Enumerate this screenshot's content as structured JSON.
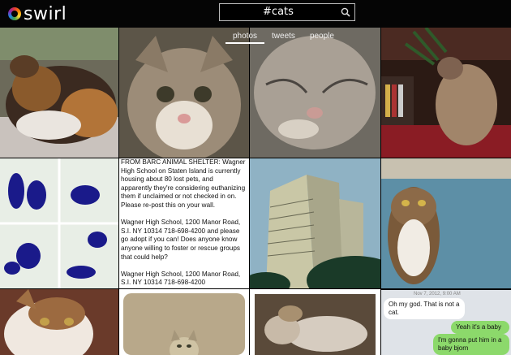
{
  "app": {
    "name": "swirl"
  },
  "search": {
    "value": "#cats"
  },
  "tabs": [
    {
      "label": "photos",
      "active": true
    },
    {
      "label": "tweets",
      "active": false
    },
    {
      "label": "people",
      "active": false
    }
  ],
  "text_post": {
    "paragraphs": [
      "FROM BARC ANIMAL SHELTER: Wagner High School on Staten Island is currently housing about 80 lost pets, and apparently they're considering euthanizing them if unclaimed or not checked in on. Please re-post this on your wall.",
      "Wagner High School, 1200 Manor Road, S.I. NY 10314 718-698-4200 and please go adopt if you can! Does anyone know anyone willing to foster or rescue groups that could help?",
      "Wagner High School, 1200 Manor Road, S.I. NY 10314 718-698-4200"
    ]
  },
  "chat": {
    "date": "Nov 7, 2012, 9:00 AM",
    "messages": [
      {
        "text": "Oh my god. That is not a cat.",
        "side": "in"
      },
      {
        "text": "Yeah it's a baby",
        "side": "out"
      },
      {
        "text": "I'm gonna put him in a baby bjorn",
        "side": "out"
      }
    ]
  }
}
